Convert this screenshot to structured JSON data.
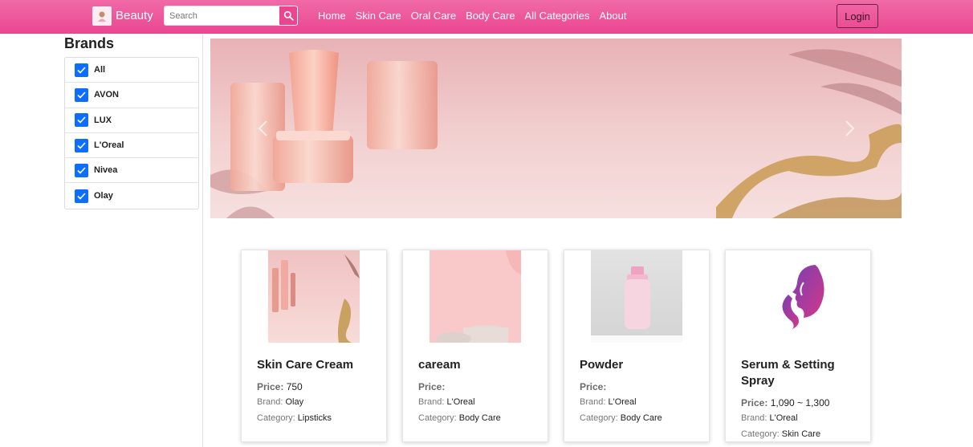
{
  "navbar": {
    "brand_name": "Beauty",
    "search_placeholder": "Search",
    "links": [
      "Home",
      "Skin Care",
      "Oral Care",
      "Body Care",
      "All Categories",
      "About"
    ],
    "login_label": "Login",
    "colors": {
      "accent": "#ea4690"
    }
  },
  "sidebar": {
    "title": "Brands",
    "brands": [
      "All",
      "AVON",
      "LUX",
      "L'Oreal",
      "Nivea",
      "Olay"
    ]
  },
  "products": [
    {
      "title": "Skin Care Cream",
      "price_label": "Price:",
      "price": "750",
      "brand_label": "Brand:",
      "brand": "Olay",
      "category_label": "Category:",
      "category": "Lipsticks"
    },
    {
      "title": "caream",
      "price_label": "Price:",
      "price": "",
      "brand_label": "Brand:",
      "brand": "L'Oreal",
      "category_label": "Category:",
      "category": "Body Care"
    },
    {
      "title": "Powder",
      "price_label": "Price:",
      "price": "",
      "brand_label": "Brand:",
      "brand": "L'Oreal",
      "category_label": "Category:",
      "category": "Body Care"
    },
    {
      "title": "Serum & Setting Spray",
      "price_label": "Price:",
      "price": "1,090 ~ 1,300",
      "brand_label": "Brand:",
      "brand": "L'Oreal",
      "category_label": "Category:",
      "category": "Skin Care"
    }
  ]
}
